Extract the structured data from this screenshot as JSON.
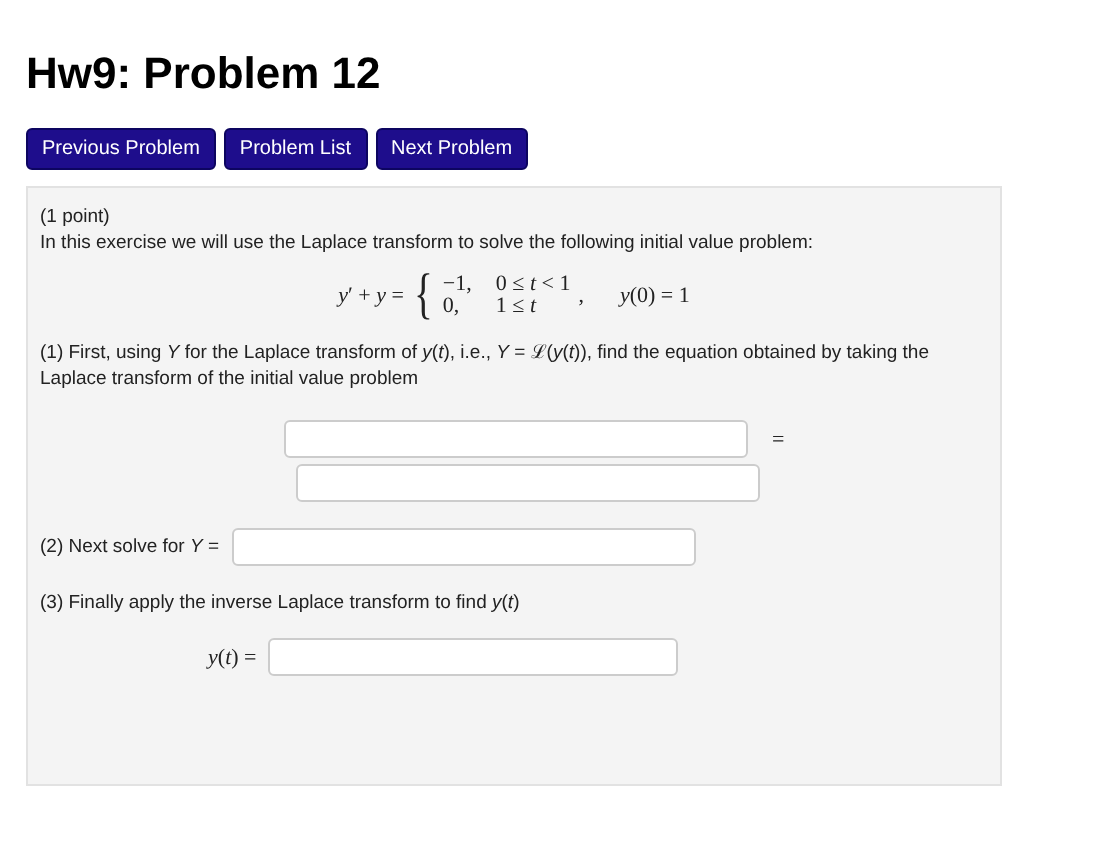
{
  "title": "Hw9: Problem 12",
  "nav_buttons": [
    "Previous Problem",
    "Problem List",
    "Next Problem"
  ],
  "problem": {
    "points": "(1 point)",
    "intro": "In this exercise we will use the Laplace transform to solve the following initial value problem:",
    "equation": {
      "lhs": "*y*′ + *y* =",
      "brace": "{",
      "cases": [
        {
          "value": "−1,",
          "condition": "0 ≤ *t* < 1"
        },
        {
          "value": "0,",
          "condition": "1 ≤ *t*"
        }
      ],
      "separator": ",",
      "initial": "*y*(0) = 1"
    },
    "part1": "(1) First, using *Y* for the Laplace transform of *y*(*t*), i.e., *Y* = ℒ(*y*(*t*)), find the equation obtained by taking the Laplace transform of the initial value problem",
    "part1_equals": "=",
    "part2_label": "(2) Next solve for *Y* =",
    "part3": "(3) Finally apply the inverse Laplace transform to find *y*(*t*)",
    "part3_label": "*y*(*t*) ="
  }
}
